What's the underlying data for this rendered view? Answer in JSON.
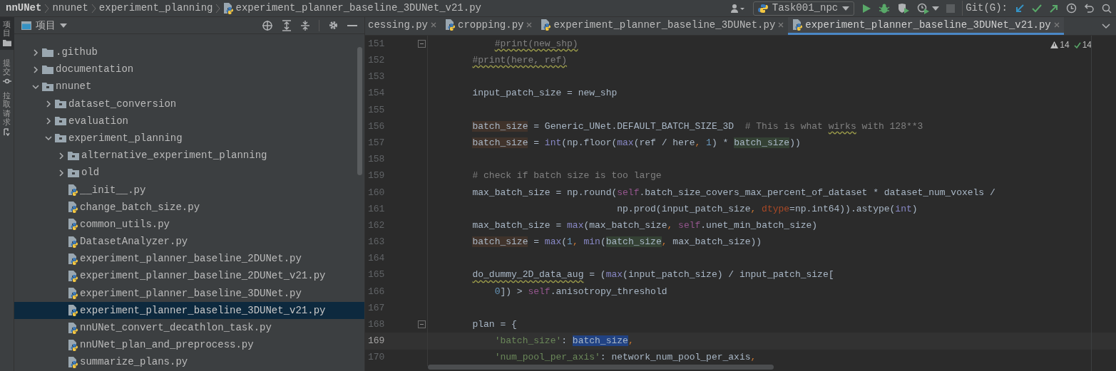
{
  "breadcrumbs": [
    {
      "label": "nnUNet",
      "kind": "project"
    },
    {
      "label": "nnunet",
      "kind": "folder"
    },
    {
      "label": "experiment_planning",
      "kind": "folder"
    },
    {
      "label": "experiment_planner_baseline_3DUNet_v21.py",
      "kind": "python"
    }
  ],
  "run_config": {
    "label": "Task001_npc"
  },
  "git_label": "Git(G):",
  "tool_strip": [
    {
      "label": "项目",
      "selected": true,
      "kind": "folder"
    },
    {
      "label": "提交",
      "selected": false,
      "kind": "commit"
    },
    {
      "label": "拉取请求",
      "selected": false,
      "kind": "pull"
    }
  ],
  "project_panel": {
    "title": "项目",
    "tree": [
      {
        "label": ".github",
        "kind": "folder",
        "expanded": false,
        "selected": false
      },
      {
        "label": "documentation",
        "kind": "folder",
        "expanded": false,
        "selected": false
      },
      {
        "label": "nnunet",
        "kind": "package",
        "expanded": true,
        "selected": false,
        "children": [
          {
            "label": "dataset_conversion",
            "kind": "package",
            "expanded": false,
            "selected": false
          },
          {
            "label": "evaluation",
            "kind": "package",
            "expanded": false,
            "selected": false
          },
          {
            "label": "experiment_planning",
            "kind": "package",
            "expanded": true,
            "selected": false,
            "children": [
              {
                "label": "alternative_experiment_planning",
                "kind": "package",
                "expanded": false,
                "selected": false
              },
              {
                "label": "old",
                "kind": "package",
                "expanded": false,
                "selected": false
              },
              {
                "label": "__init__.py",
                "kind": "python",
                "selected": false
              },
              {
                "label": "change_batch_size.py",
                "kind": "python",
                "selected": false
              },
              {
                "label": "common_utils.py",
                "kind": "python",
                "selected": false
              },
              {
                "label": "DatasetAnalyzer.py",
                "kind": "python",
                "selected": false
              },
              {
                "label": "experiment_planner_baseline_2DUNet.py",
                "kind": "python",
                "selected": false
              },
              {
                "label": "experiment_planner_baseline_2DUNet_v21.py",
                "kind": "python",
                "selected": false
              },
              {
                "label": "experiment_planner_baseline_3DUNet.py",
                "kind": "python",
                "selected": false
              },
              {
                "label": "experiment_planner_baseline_3DUNet_v21.py",
                "kind": "python",
                "selected": true
              },
              {
                "label": "nnUNet_convert_decathlon_task.py",
                "kind": "python",
                "selected": false
              },
              {
                "label": "nnUNet_plan_and_preprocess.py",
                "kind": "python",
                "selected": false
              },
              {
                "label": "summarize_plans.py",
                "kind": "python",
                "selected": false
              }
            ]
          }
        ]
      }
    ]
  },
  "tabs": [
    {
      "label": "cessing.py",
      "icon": false,
      "selected": false
    },
    {
      "label": "cropping.py",
      "icon": true,
      "selected": false
    },
    {
      "label": "experiment_planner_baseline_3DUNet.py",
      "icon": true,
      "selected": false
    },
    {
      "label": "experiment_planner_baseline_3DUNet_v21.py",
      "icon": true,
      "selected": true
    }
  ],
  "inspections": {
    "warnings": "14",
    "weak_warnings": "14"
  },
  "code_lines": [
    {
      "number": "151",
      "fold_end": true,
      "tokens": [
        {
          "kind": "comment",
          "text": "            #print(new_shp)",
          "warn": true
        }
      ]
    },
    {
      "number": "152",
      "tokens": [
        {
          "kind": "comment",
          "text": "        #print(here, ref)",
          "warn": true
        }
      ]
    },
    {
      "number": "153"
    },
    {
      "number": "154",
      "tokens": [
        {
          "text": "        input_patch_size = new_shp"
        }
      ]
    },
    {
      "number": "155"
    },
    {
      "number": "156",
      "tokens": [
        {
          "text": "        batch_size",
          "written": true
        },
        {
          "text": " = Generic_UNet.DEFAULT_BATCH_SIZE_3D  "
        },
        {
          "kind": "comment",
          "text": "# This is what "
        },
        {
          "kind": "comment",
          "text": "wirks",
          "warn": true
        },
        {
          "kind": "comment",
          "text": " with 128**3"
        }
      ]
    },
    {
      "number": "157",
      "tokens": [
        {
          "text": "        batch_size",
          "written": true
        },
        {
          "text": " = "
        },
        {
          "kind": "builtin",
          "text": "int"
        },
        {
          "text": "(np.floor("
        },
        {
          "kind": "builtin",
          "text": "max"
        },
        {
          "text": "(ref / here"
        },
        {
          "kind": "punct",
          "text": ", "
        },
        {
          "kind": "num",
          "text": "1"
        },
        {
          "text": ") * "
        },
        {
          "text": "batch_size",
          "read": true
        },
        {
          "text": "))"
        }
      ]
    },
    {
      "number": "158"
    },
    {
      "number": "159",
      "tokens": [
        {
          "kind": "comment",
          "text": "        # check if batch size is too large"
        }
      ]
    },
    {
      "number": "160",
      "tokens": [
        {
          "text": "        max_batch_size = np.round("
        },
        {
          "kind": "self",
          "text": "self"
        },
        {
          "text": ".batch_size_covers_max_percent_of_dataset * dataset_num_voxels /"
        }
      ]
    },
    {
      "number": "161",
      "tokens": [
        {
          "text": "                                  np.prod(input_patch_size"
        },
        {
          "kind": "punct",
          "text": ", "
        },
        {
          "kind": "param",
          "text": "dtype"
        },
        {
          "text": "=np.int64)).astype("
        },
        {
          "kind": "builtin",
          "text": "int"
        },
        {
          "text": ")"
        }
      ]
    },
    {
      "number": "162",
      "tokens": [
        {
          "text": "        max_batch_size = "
        },
        {
          "kind": "builtin",
          "text": "max"
        },
        {
          "text": "(max_batch_size"
        },
        {
          "kind": "punct",
          "text": ", "
        },
        {
          "kind": "self",
          "text": "self"
        },
        {
          "text": ".unet_min_batch_size)"
        }
      ]
    },
    {
      "number": "163",
      "tokens": [
        {
          "text": "        batch_size",
          "written": true
        },
        {
          "text": " = "
        },
        {
          "kind": "builtin",
          "text": "max"
        },
        {
          "text": "("
        },
        {
          "kind": "num",
          "text": "1"
        },
        {
          "kind": "punct",
          "text": ", "
        },
        {
          "kind": "builtin",
          "text": "min"
        },
        {
          "text": "("
        },
        {
          "text": "batch_size",
          "read": true
        },
        {
          "kind": "punct",
          "text": ", "
        },
        {
          "text": "max_batch_size))"
        }
      ]
    },
    {
      "number": "164"
    },
    {
      "number": "165",
      "tokens": [
        {
          "text": "        do_dummy_2D_data_aug",
          "warn": true
        },
        {
          "text": " = ("
        },
        {
          "kind": "builtin",
          "text": "max"
        },
        {
          "text": "(input_patch_size) / input_patch_size["
        }
      ]
    },
    {
      "number": "166",
      "tokens": [
        {
          "kind": "num",
          "text": "            0"
        },
        {
          "text": "]) > "
        },
        {
          "kind": "self",
          "text": "self"
        },
        {
          "text": ".anisotropy_threshold"
        }
      ]
    },
    {
      "number": "167"
    },
    {
      "number": "168",
      "fold_start": true,
      "tokens": [
        {
          "text": "        plan = {"
        }
      ]
    },
    {
      "number": "169",
      "current": true,
      "tokens": [
        {
          "kind": "str",
          "text": "            'batch_size'"
        },
        {
          "text": ": "
        },
        {
          "text": "batch_size",
          "selected": true
        },
        {
          "kind": "punct",
          "text": ","
        }
      ]
    },
    {
      "number": "170",
      "tokens": [
        {
          "kind": "str",
          "text": "            'num_pool_per_axis'"
        },
        {
          "text": ": network_num_pool_per_axis"
        },
        {
          "kind": "punct",
          "text": ","
        }
      ]
    }
  ]
}
